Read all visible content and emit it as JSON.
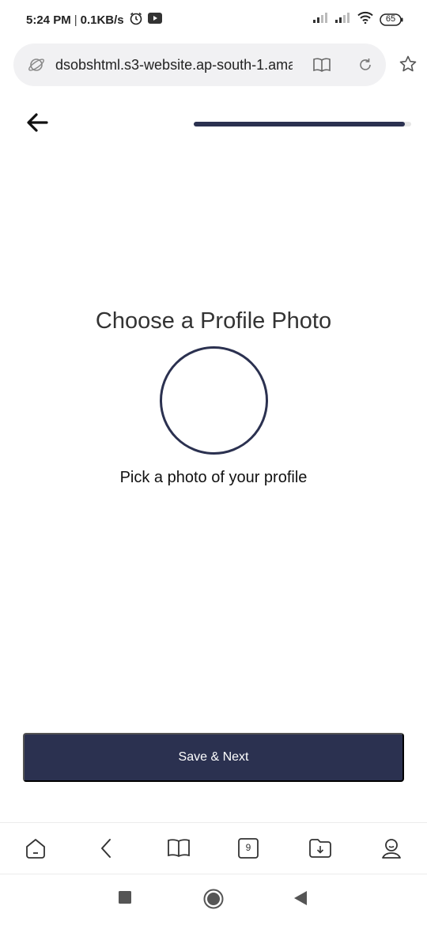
{
  "status_bar": {
    "time": "5:24 PM",
    "separator": "|",
    "net_speed": "0.1KB/s",
    "battery": "65",
    "icons": [
      "alarm-icon",
      "youtube-icon",
      "signal-icon",
      "wifi-icon",
      "battery-icon"
    ]
  },
  "browser": {
    "url": "dsobshtml.s3-website.ap-south-1.amazonaws.com",
    "icons": [
      "globe-icon",
      "reader-mode-icon",
      "reload-icon",
      "star-icon"
    ]
  },
  "page": {
    "progress_fraction": 0.97,
    "title": "Choose a Profile Photo",
    "subtitle": "Pick a photo of your profile",
    "save_button": "Save & Next"
  },
  "bottom_toolbar": {
    "tab_count": "9",
    "icons": [
      "home-icon",
      "back-icon",
      "bookmarks-icon",
      "tabs-icon",
      "downloads-icon",
      "profile-icon"
    ]
  },
  "colors": {
    "primary": "#2b3150",
    "url_bar_bg": "#f1f1f3",
    "progress_track": "#e6e6e6"
  }
}
